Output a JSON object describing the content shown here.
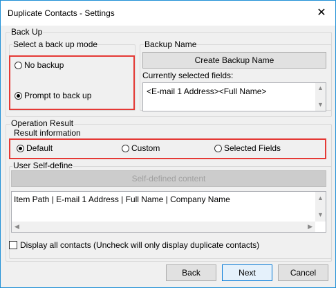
{
  "window": {
    "title": "Duplicate Contacts - Settings",
    "close_glyph": "✕"
  },
  "backup": {
    "group_label": "Back Up",
    "mode_label": "Select a back up mode",
    "no_backup": "No backup",
    "prompt_backup": "Prompt to back up",
    "selected_mode": "Prompt to back up",
    "name_label": "Backup Name",
    "create_button": "Create Backup Name",
    "current_fields_label": "Currently selected fields:",
    "current_fields_value": "<E-mail 1 Address><Full Name>"
  },
  "operation": {
    "group_label": "Operation Result",
    "info_label": "Result information",
    "default": "Default",
    "custom": "Custom",
    "selected_fields": "Selected Fields",
    "selected_option": "Default",
    "self_define_label": "User Self-define",
    "self_defined_button": "Self-defined content",
    "self_defined_value": "Item Path | E-mail 1 Address | Full Name | Company Name"
  },
  "display_all": {
    "label": "Display all contacts (Uncheck will only display duplicate contacts)",
    "checked": false
  },
  "buttons": {
    "back": "Back",
    "next": "Next",
    "cancel": "Cancel"
  },
  "colors": {
    "highlight": "#e53935",
    "border_accent": "#1e8fd6"
  }
}
